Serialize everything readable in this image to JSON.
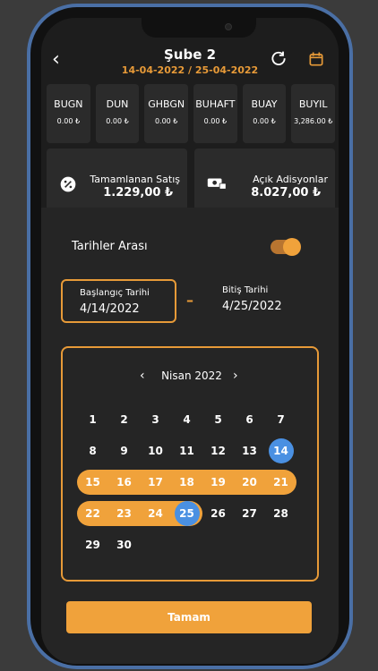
{
  "header": {
    "title": "Şube 2",
    "dates": "14-04-2022 / 25-04-2022"
  },
  "tiles": [
    {
      "label": "BUGN",
      "value": "0.00 ₺"
    },
    {
      "label": "DUN",
      "value": "0.00 ₺"
    },
    {
      "label": "GHBGN",
      "value": "0.00 ₺"
    },
    {
      "label": "BUHAFT",
      "value": "0.00 ₺"
    },
    {
      "label": "BUAY",
      "value": "0.00 ₺"
    },
    {
      "label": "BUYIL",
      "value": "3,286.00 ₺"
    }
  ],
  "cards": [
    {
      "label": "Tamamlanan Satış",
      "value": "1.229,00 ₺"
    },
    {
      "label": "Açık Adisyonlar",
      "value": "8.027,00 ₺"
    }
  ],
  "sheet": {
    "range_label": "Tarihler Arası",
    "start_label": "Başlangıç Tarihi",
    "start_value": "4/14/2022",
    "end_label": "Bitiş Tarihi",
    "end_value": "4/25/2022",
    "month": "Nisan 2022",
    "confirm": "Tamam"
  },
  "calendar": {
    "weeks": [
      [
        "1",
        "2",
        "3",
        "4",
        "5",
        "6",
        "7"
      ],
      [
        "8",
        "9",
        "10",
        "11",
        "12",
        "13",
        "14"
      ],
      [
        "15",
        "16",
        "17",
        "18",
        "19",
        "20",
        "21"
      ],
      [
        "22",
        "23",
        "24",
        "25",
        "26",
        "27",
        "28"
      ],
      [
        "29",
        "30",
        "",
        "",
        "",
        "",
        ""
      ]
    ]
  },
  "colors": {
    "accent": "#f0a23b",
    "selected": "#4a90e2"
  }
}
